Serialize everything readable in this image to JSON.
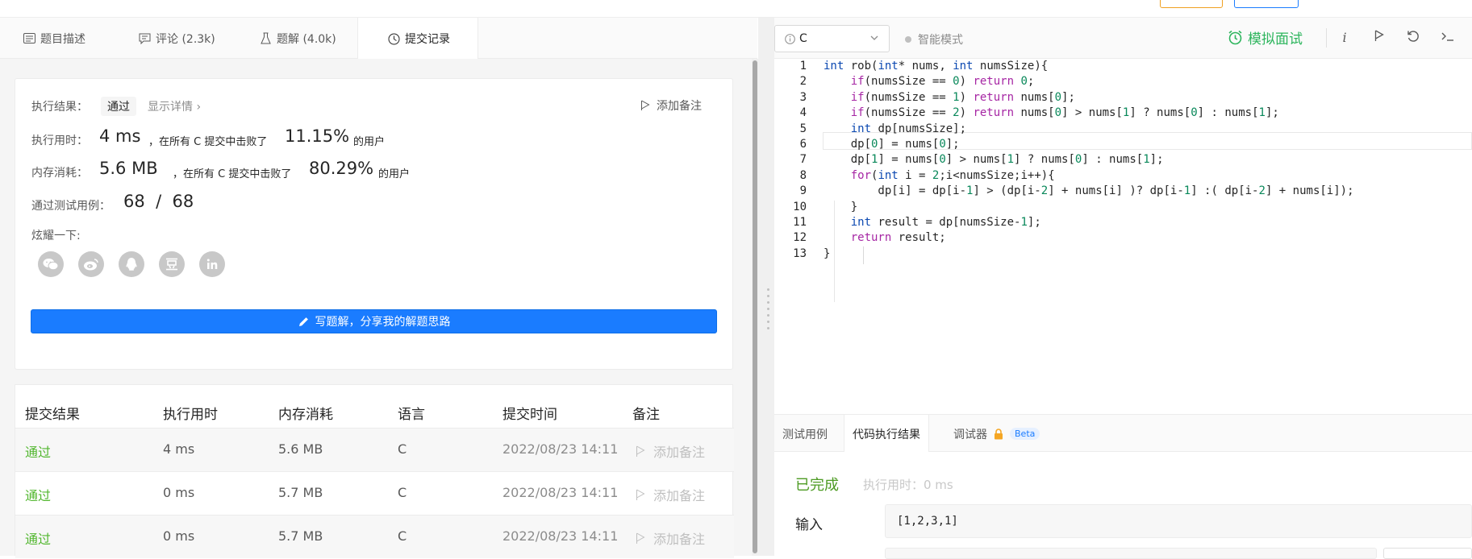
{
  "colors": {
    "accent_blue": "#1a7cff",
    "pass_green": "#52b72f",
    "mock_green": "#2db55d",
    "done_green": "#4d9b23"
  },
  "tabs": [
    {
      "label": "题目描述",
      "icon": "description-icon"
    },
    {
      "label": "评论 (2.3k)",
      "icon": "comment-icon"
    },
    {
      "label": "题解 (4.0k)",
      "icon": "flask-icon"
    },
    {
      "label": "提交记录",
      "icon": "clock-icon",
      "active": true
    }
  ],
  "result": {
    "status_label": "执行结果：",
    "status": "通过",
    "details_link": "显示详情 ›",
    "add_note": "添加备注",
    "time_label": "执行用时：",
    "time_value": "4 ms",
    "time_text": "，在所有 C 提交中击败了",
    "time_pct": "11.15%",
    "time_suffix": "的用户",
    "mem_label": "内存消耗：",
    "mem_value": "5.6 MB",
    "mem_text": "，在所有 C 提交中击败了",
    "mem_pct": "80.29%",
    "mem_suffix": "的用户",
    "cases_label": "通过测试用例：",
    "cases_value": "68  /  68",
    "share_label": "炫耀一下:",
    "share_icons": [
      "wechat-icon",
      "weibo-icon",
      "qq-icon",
      "douban-icon",
      "linkedin-icon"
    ],
    "write_button": "写题解，分享我的解题思路"
  },
  "table": {
    "headers": [
      "提交结果",
      "执行用时",
      "内存消耗",
      "语言",
      "提交时间",
      "备注"
    ],
    "rows": [
      {
        "status": "通过",
        "time": "4 ms",
        "memory": "5.6 MB",
        "lang": "C",
        "submitted": "2022/08/23 14:11",
        "note": "添加备注"
      },
      {
        "status": "通过",
        "time": "0 ms",
        "memory": "5.7 MB",
        "lang": "C",
        "submitted": "2022/08/23 14:11",
        "note": "添加备注"
      },
      {
        "status": "通过",
        "time": "0 ms",
        "memory": "5.7 MB",
        "lang": "C",
        "submitted": "2022/08/23 14:11",
        "note": "添加备注"
      }
    ]
  },
  "editor_toolbar": {
    "language": "C",
    "smart_mode": "智能模式",
    "mock_interview": "模拟面试",
    "icons": [
      "info-icon",
      "run-icon",
      "reset-icon",
      "console-icon"
    ]
  },
  "code_lines": [
    "int rob(int* nums, int numsSize){",
    "    if(numsSize == 0) return 0;",
    "    if(numsSize == 1) return nums[0];",
    "    if(numsSize == 2) return nums[0] > nums[1] ? nums[0] : nums[1];",
    "    int dp[numsSize];",
    "    dp[0] = nums[0];",
    "    dp[1] = nums[0] > nums[1] ? nums[0] : nums[1];",
    "    for(int i = 2;i<numsSize;i++){",
    "        dp[i] = dp[i-1] > (dp[i-2] + nums[i] )? dp[i-1] :( dp[i-2] + nums[i]);",
    "    }",
    "    int result = dp[numsSize-1];",
    "    return result;",
    "}"
  ],
  "console": {
    "tabs": [
      "测试用例",
      "代码执行结果",
      "调试器"
    ],
    "beta": "Beta",
    "status": "已完成",
    "exec_time": "执行用时：0 ms",
    "input_label": "输入",
    "input_value": "[1,2,3,1]"
  }
}
